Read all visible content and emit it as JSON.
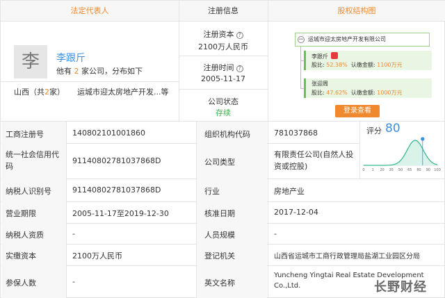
{
  "headers": {
    "legal_rep": "法定代表人",
    "reg_info": "注册信息",
    "equity": "股权结构图"
  },
  "legal_rep": {
    "avatar_char": "李",
    "name": "李跟斤",
    "companies_prefix": "他有",
    "companies_count": "2",
    "companies_suffix": "家公司，分布如下",
    "region_prefix": "山西（共",
    "region_count": "2",
    "region_suffix": "家）",
    "company_short": "运城市迎太房地产开发...等"
  },
  "reg_info": {
    "capital_label": "注册资本",
    "capital_value": "2100万人民币",
    "date_label": "注册时间",
    "date_value": "2005-11-17",
    "status_label": "公司状态",
    "status_value": "存续"
  },
  "equity": {
    "company": "运城市迎太房地产开发有限公司",
    "holders": [
      {
        "name": "李跟斤",
        "ratio_label": "股比:",
        "ratio": "52.38%",
        "sub_label": "认缴金额:",
        "amount": "1100万元"
      },
      {
        "name": "张迎周",
        "ratio_label": "股比:",
        "ratio": "47.62%",
        "sub_label": "认缴金额:",
        "amount": "1000万元"
      }
    ],
    "button": "登录查看"
  },
  "table": {
    "r1": {
      "l1": "工商注册号",
      "v1": "140802101001860",
      "l2": "组织机构代码",
      "v2": "781037868"
    },
    "r2": {
      "l1": "统一社会信用代码",
      "v1": "91140802781037868D",
      "l2": "公司类型",
      "v2": "有限责任公司(自然人投资或控股)"
    },
    "r3": {
      "l1": "纳税人识别号",
      "v1": "91140802781037868D",
      "l2": "行业",
      "v2": "房地产业"
    },
    "r4": {
      "l1": "营业期限",
      "v1": "2005-11-17至2019-12-30",
      "l2": "核准日期",
      "v2": "2017-12-04"
    },
    "r5": {
      "l1": "纳税人资质",
      "v1": "-",
      "l2": "人员规模",
      "v2": "-"
    },
    "r6": {
      "l1": "实缴资本",
      "v1": "2100万人民币",
      "l2": "登记机关",
      "v2": "山西省运城市工商行政管理局盐湖工业园区分局"
    },
    "r7": {
      "l1": "参保人数",
      "v1": "-",
      "l2": "英文名称",
      "v2": "Yuncheng Yingtai Real Estate Development Co.,Ltd."
    }
  },
  "score": {
    "label": "评分",
    "value": "80",
    "ticks": [
      "0",
      "1",
      "20",
      "35",
      "50",
      "65",
      "80",
      "90",
      "100"
    ],
    "marker": 80,
    "accent": "#3b8fe0",
    "curve": "#2db58c"
  },
  "watermark": "长野财经",
  "colors": {
    "orange": "#f0882e",
    "blue": "#3b8fe0",
    "green": "#3cb34b"
  }
}
